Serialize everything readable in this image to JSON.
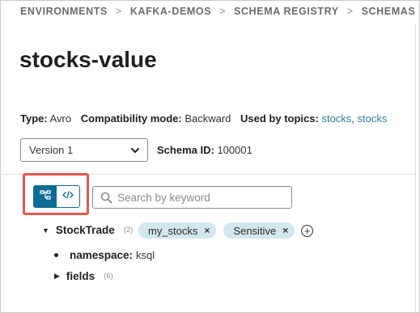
{
  "breadcrumb": {
    "items": [
      "ENVIRONMENTS",
      "KAFKA-DEMOS",
      "SCHEMA REGISTRY",
      "SCHEMAS"
    ],
    "separator": ">"
  },
  "page": {
    "title": "stocks-value"
  },
  "meta": {
    "type_label": "Type:",
    "type_value": "Avro",
    "compat_label": "Compatibility mode:",
    "compat_value": "Backward",
    "topics_label": "Used by topics:",
    "topics": [
      "stocks",
      "stocks"
    ],
    "topics_separator": ","
  },
  "version": {
    "selected": "Version 1"
  },
  "schema": {
    "id_label": "Schema ID:",
    "id_value": "100001"
  },
  "search": {
    "placeholder": "Search by keyword",
    "value": ""
  },
  "view_toggle": {
    "active": "tree-view",
    "options": [
      "tree-view-icon",
      "code-view-icon"
    ]
  },
  "tree": {
    "root": {
      "name": "StockTrade",
      "count": "(2)",
      "expanded": true
    },
    "tags": [
      {
        "label": "my_stocks"
      },
      {
        "label": "Sensitive"
      }
    ],
    "tag_remove": "×",
    "add_tag": "+",
    "children": [
      {
        "label": "namespace:",
        "value": "ksql"
      },
      {
        "label": "fields",
        "count": "(6)",
        "expanded": false
      }
    ]
  },
  "colors": {
    "accent": "#0d6c95",
    "link": "#2e7fa1",
    "tag_bg": "#d3e7ef",
    "highlight": "#e2574f"
  }
}
